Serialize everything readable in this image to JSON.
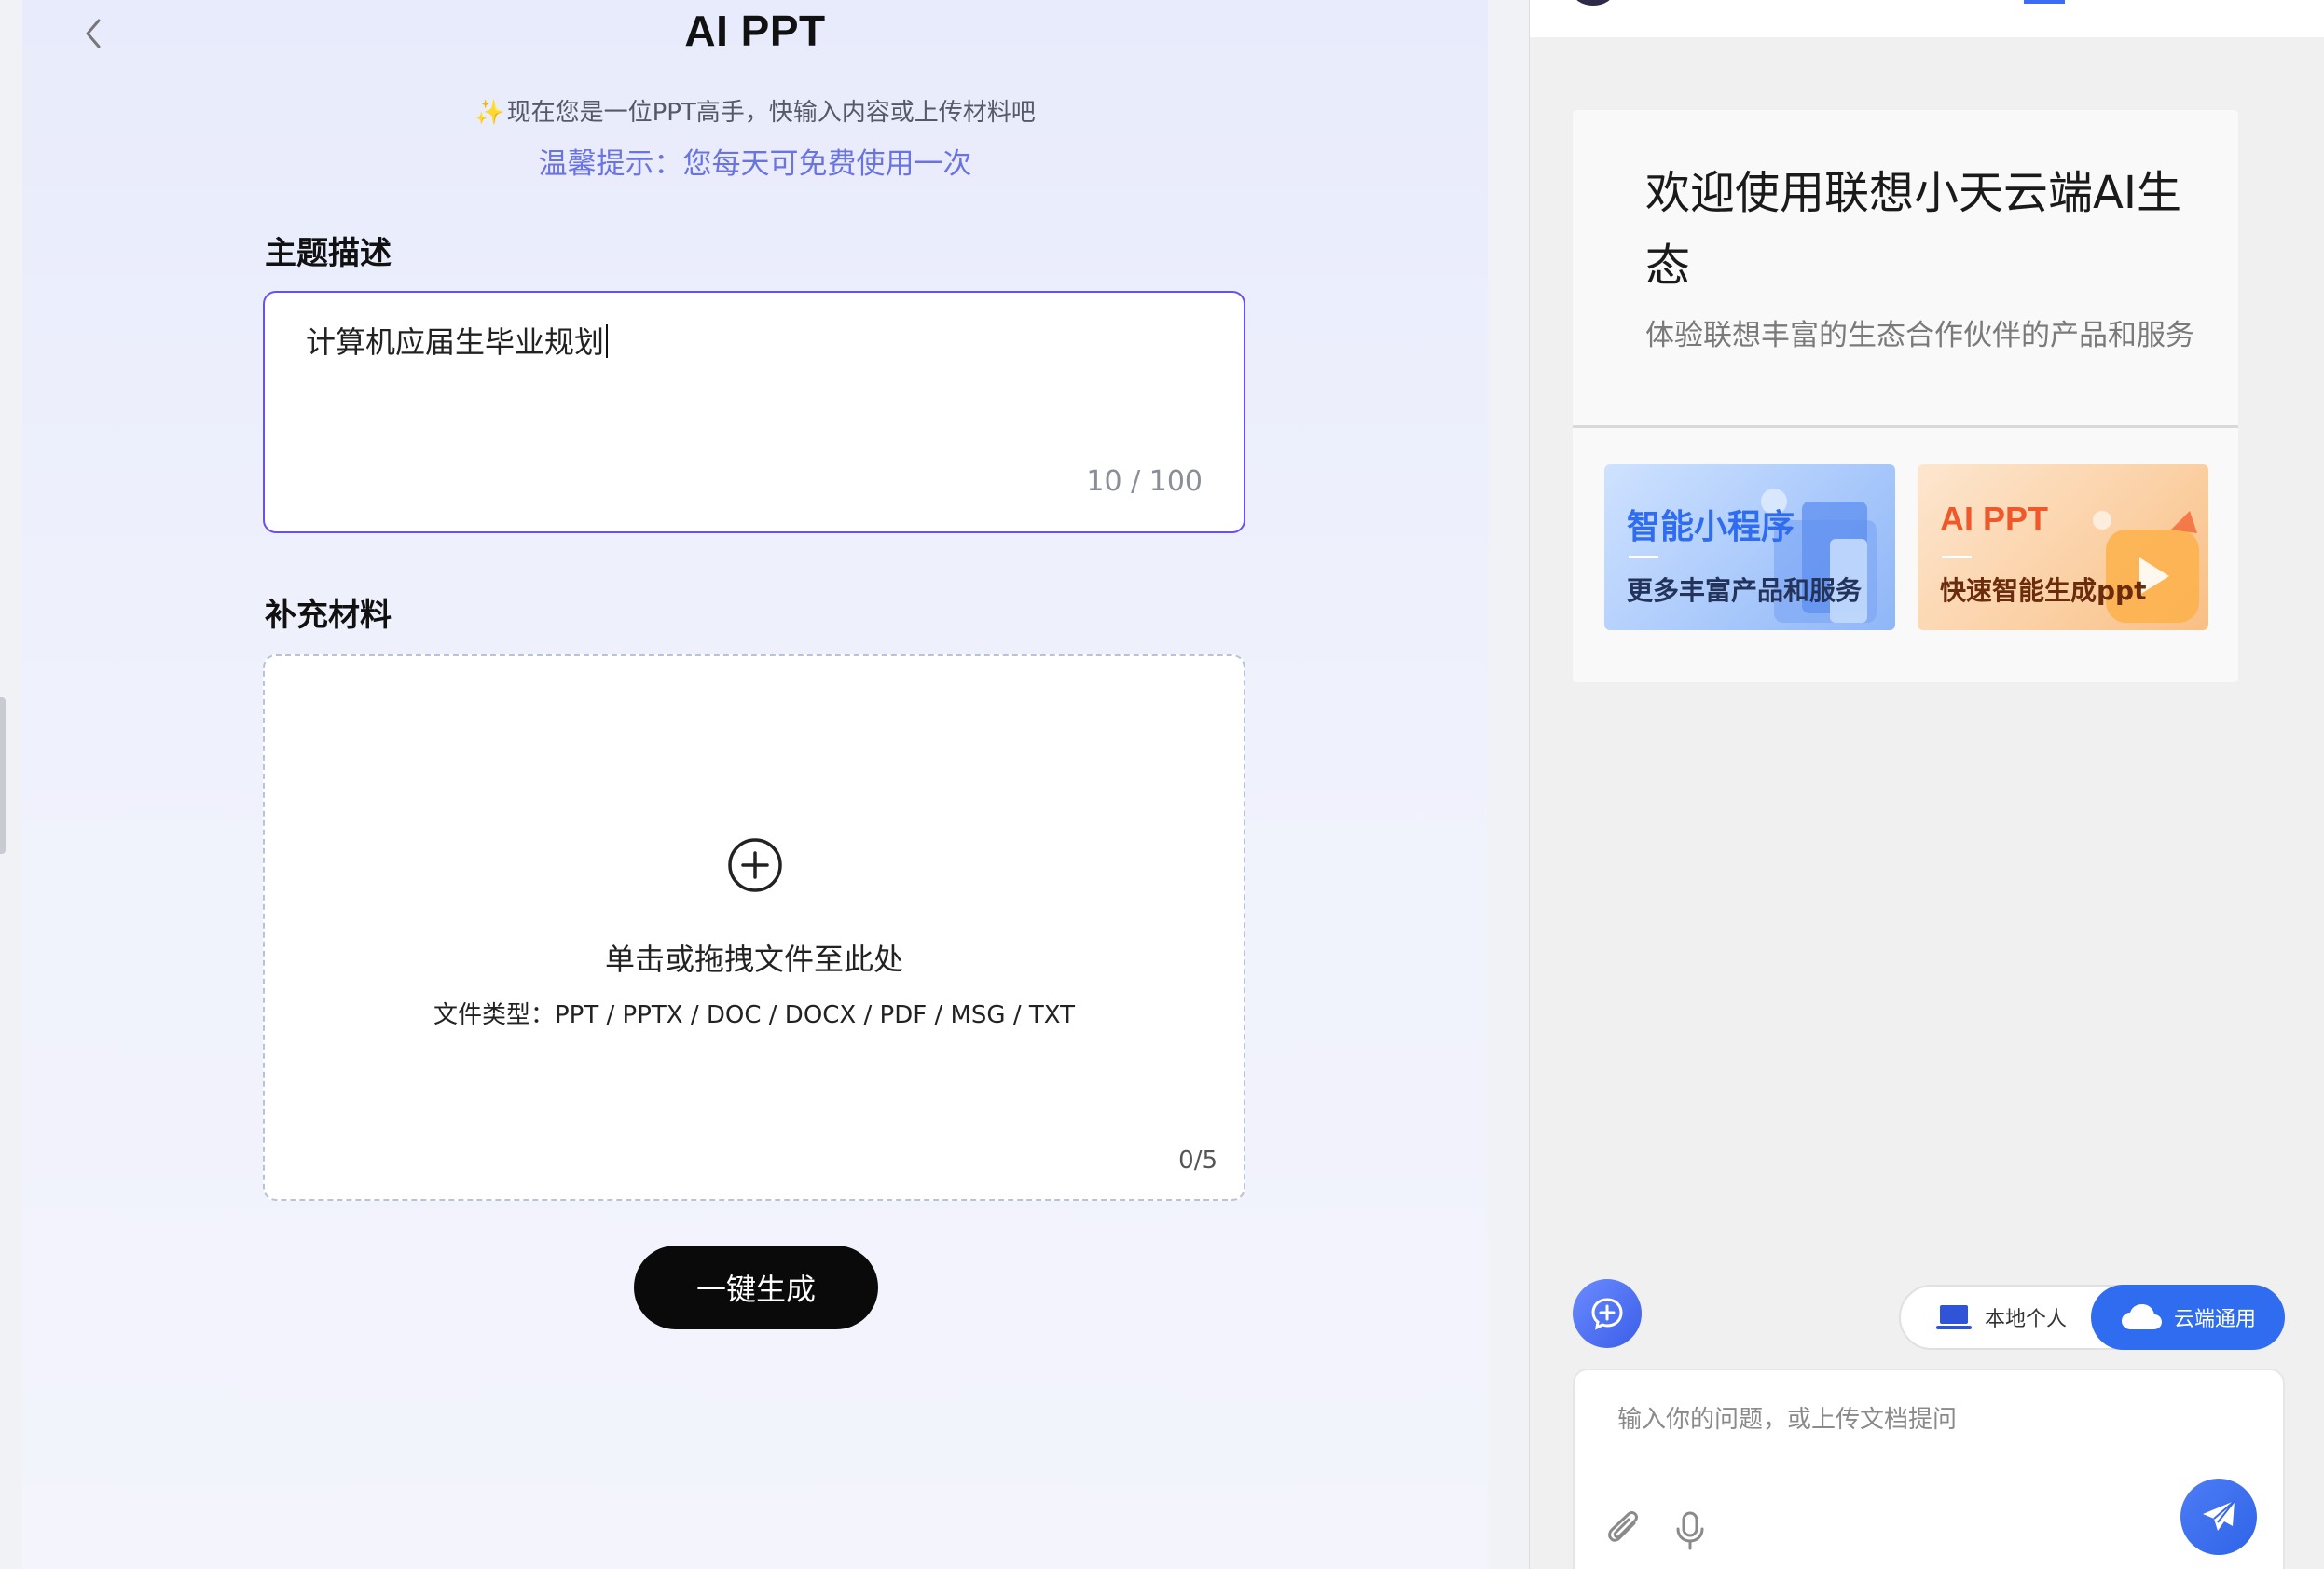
{
  "colors": {
    "accent_purple": "#6b4ff0",
    "tip_blue": "#6a74e0",
    "primary_blue": "#2f6cf0",
    "generate_button_bg": "#0a0a0a"
  },
  "header": {
    "back_icon": "chevron-left-icon",
    "title": "AI PPT",
    "subtitle_icon": "sparkle-icon",
    "subtitle": "现在您是一位PPT高手，快输入内容或上传材料吧",
    "tip": "温馨提示：您每天可免费使用一次"
  },
  "topic": {
    "label": "主题描述",
    "value": "计算机应届生毕业规划",
    "counter": "10 / 100"
  },
  "materials": {
    "label": "补充材料",
    "upload_icon": "plus-circle-icon",
    "hint": "单击或拖拽文件至此处",
    "file_types": "文件类型：PPT / PPTX / DOC / DOCX / PDF / MSG / TXT",
    "counter": "0/5"
  },
  "generate_button": {
    "label": "一键生成"
  },
  "assistant": {
    "welcome_title": "欢迎使用联想小天云端AI生态",
    "welcome_desc": "体验联想丰富的生态合作伙伴的产品和服务",
    "cards": [
      {
        "title": "智能小程序",
        "subtitle": "更多丰富产品和服务"
      },
      {
        "title": "AI PPT",
        "subtitle": "快速智能生成ppt"
      }
    ],
    "new_chat_icon": "new-chat-icon",
    "mode_local": {
      "label": "本地个人",
      "icon": "laptop-icon"
    },
    "mode_cloud": {
      "label": "云端通用",
      "icon": "cloud-icon",
      "active": true
    },
    "input_placeholder": "输入你的问题，或上传文档提问",
    "attach_icon": "paperclip-icon",
    "mic_icon": "microphone-icon",
    "send_icon": "send-icon"
  }
}
